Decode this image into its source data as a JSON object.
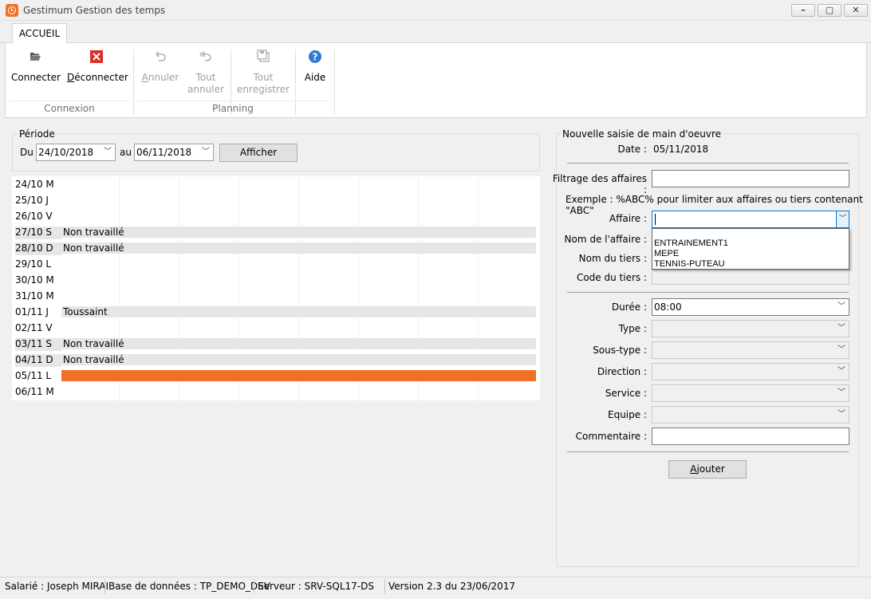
{
  "window": {
    "title": "Gestimum Gestion des temps"
  },
  "ribbon": {
    "tab": "ACCUEIL",
    "buttons": {
      "connecter": "Connecter",
      "deconnecter_prefix": "D",
      "deconnecter_rest": "éconnecter",
      "annuler_underlined": "A",
      "annuler_rest": "nnuler",
      "tout_annuler_1": "Tout",
      "tout_annuler_2": "annuler",
      "tout_enregistrer_1": "Tout",
      "tout_enregistrer_2": "enregistrer",
      "aide": "Aide"
    },
    "groups": {
      "connexion": "Connexion",
      "planning": "Planning"
    }
  },
  "periode": {
    "legend": "Période",
    "du_label": "Du",
    "du_value": "24/10/2018",
    "au_label": "au",
    "au_value": "06/11/2018",
    "afficher": "Afficher"
  },
  "grid": {
    "rows": [
      {
        "date": "24/10 M",
        "note": ""
      },
      {
        "date": "25/10 J",
        "note": ""
      },
      {
        "date": "26/10 V",
        "note": ""
      },
      {
        "date": "27/10 S",
        "note": "Non travaillé"
      },
      {
        "date": "28/10 D",
        "note": "Non travaillé"
      },
      {
        "date": "29/10 L",
        "note": ""
      },
      {
        "date": "30/10 M",
        "note": ""
      },
      {
        "date": "31/10 M",
        "note": ""
      },
      {
        "date": "01/11 J",
        "note": "Toussaint"
      },
      {
        "date": "02/11 V",
        "note": ""
      },
      {
        "date": "03/11 S",
        "note": "Non travaillé"
      },
      {
        "date": "04/11 D",
        "note": "Non travaillé"
      },
      {
        "date": "05/11 L",
        "note": ""
      },
      {
        "date": "06/11 M",
        "note": ""
      }
    ]
  },
  "saisie": {
    "legend": "Nouvelle saisie de main d'oeuvre",
    "date_label": "Date :",
    "date_value": "05/11/2018",
    "filtrage_label": "Filtrage des affaires :",
    "filtrage_value": "",
    "exemple": "Exemple : %ABC% pour limiter aux affaires ou tiers contenant \"ABC\"",
    "affaire_label": "Affaire :",
    "affaire_value": "",
    "affaire_options": [
      "ENTRAINEMENT1",
      "MEPE",
      "TENNIS-PUTEAU"
    ],
    "nom_affaire_label": "Nom de l'affaire :",
    "nom_tiers_label": "Nom du tiers :",
    "code_tiers_label": "Code du tiers :",
    "duree_label": "Durée :",
    "duree_value": "08:00",
    "type_label": "Type :",
    "soustype_label": "Sous-type :",
    "direction_label": "Direction :",
    "service_label": "Service :",
    "equipe_label": "Equipe :",
    "commentaire_label": "Commentaire :",
    "commentaire_value": "",
    "ajouter_underlined": "A",
    "ajouter_rest": "jouter"
  },
  "status": {
    "salarie": "Salarié : Joseph MIRAI",
    "base": "Base de données : TP_DEMO_DEV",
    "serveur": "Serveur : SRV-SQL17-DS",
    "version": "Version 2.3 du 23/06/2017"
  },
  "colors": {
    "accent": "#ef7125",
    "weekend_bar": "#e6e6e6",
    "focus": "#0078d7"
  },
  "icons": [
    "clock-app-icon",
    "folder-open-icon",
    "red-x-icon",
    "undo-icon",
    "undo-all-icon",
    "save-all-icon",
    "help-icon",
    "chevron-down-icon"
  ]
}
